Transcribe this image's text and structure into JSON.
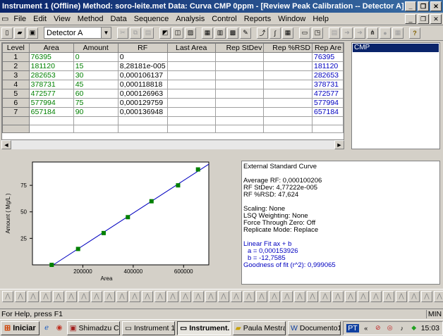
{
  "window": {
    "title": "Instrument 1 (Offline)   Method: soro-leite.met   Data: Curva CMP 0ppm - [Review Peak Calibration -- Detector A]"
  },
  "menu": [
    "File",
    "Edit",
    "View",
    "Method",
    "Data",
    "Sequence",
    "Analysis",
    "Control",
    "Reports",
    "Window",
    "Help"
  ],
  "toolbar": {
    "detector": "Detector A"
  },
  "table": {
    "headers": [
      "Level",
      "Area",
      "Amount",
      "RF",
      "Last Area",
      "Rep StDev",
      "Rep %RSD",
      "Rep Are"
    ],
    "rows": [
      {
        "level": "1",
        "area": "76395",
        "amount": "0",
        "rf": "0",
        "rep_area": "76395"
      },
      {
        "level": "2",
        "area": "181120",
        "amount": "15",
        "rf": "8,28181e-005",
        "rep_area": "181120"
      },
      {
        "level": "3",
        "area": "282653",
        "amount": "30",
        "rf": "0,000106137",
        "rep_area": "282653"
      },
      {
        "level": "4",
        "area": "378731",
        "amount": "45",
        "rf": "0,000118818",
        "rep_area": "378731"
      },
      {
        "level": "5",
        "area": "472577",
        "amount": "60",
        "rf": "0,000126963",
        "rep_area": "472577"
      },
      {
        "level": "6",
        "area": "577994",
        "amount": "75",
        "rf": "0,000129759",
        "rep_area": "577994"
      },
      {
        "level": "7",
        "area": "657184",
        "amount": "90",
        "rf": "0,000136948",
        "rep_area": "657184"
      }
    ]
  },
  "compound": {
    "selected": "CMP"
  },
  "chart_data": {
    "type": "scatter",
    "xlabel": "Area",
    "ylabel": "Amount ( Mg/L )",
    "xlim": [
      0,
      700000
    ],
    "ylim": [
      0,
      97
    ],
    "xticks": [
      200000,
      400000,
      600000
    ],
    "xtick_labels": [
      "200000",
      "400000",
      "600000"
    ],
    "yticks": [
      25,
      50,
      75
    ],
    "ytick_labels": [
      "25",
      "50",
      "75"
    ],
    "points": [
      {
        "x": 76395,
        "y": 0
      },
      {
        "x": 181120,
        "y": 15
      },
      {
        "x": 282653,
        "y": 30
      },
      {
        "x": 378731,
        "y": 45
      },
      {
        "x": 472577,
        "y": 60
      },
      {
        "x": 577994,
        "y": 75
      },
      {
        "x": 657184,
        "y": 90
      }
    ],
    "fit": {
      "a": 0.000153926,
      "b": -12.7585
    },
    "point_color": "#008000",
    "line_color": "#0000c0"
  },
  "info": {
    "title": "External Standard Curve",
    "avg_rf": "Average RF: 0,000100206",
    "rf_stdev": "RF StDev: 4,77222e-005",
    "rf_rsd": "RF %RSD: 47,624",
    "scaling": "Scaling: None",
    "lsq": "LSQ Weighting: None",
    "force": "Force Through Zero: Off",
    "replicate": "Replicate Mode: Replace",
    "fit_title": "Linear Fit   ax + b",
    "a": "a = 0,000153926",
    "b": "b = -12,7585",
    "goodness": "Goodness of fit (r^2): 0,999065"
  },
  "status": {
    "message": "For Help, press F1",
    "indicator": "MIN"
  },
  "taskbar": {
    "start": "Iniciar",
    "tasks": [
      "Shimadzu CL...",
      "Instrument 1...",
      "Instrument...",
      "Paula Mestrado",
      "Documento1 ..."
    ],
    "lang": "PT",
    "time": "15:03"
  }
}
